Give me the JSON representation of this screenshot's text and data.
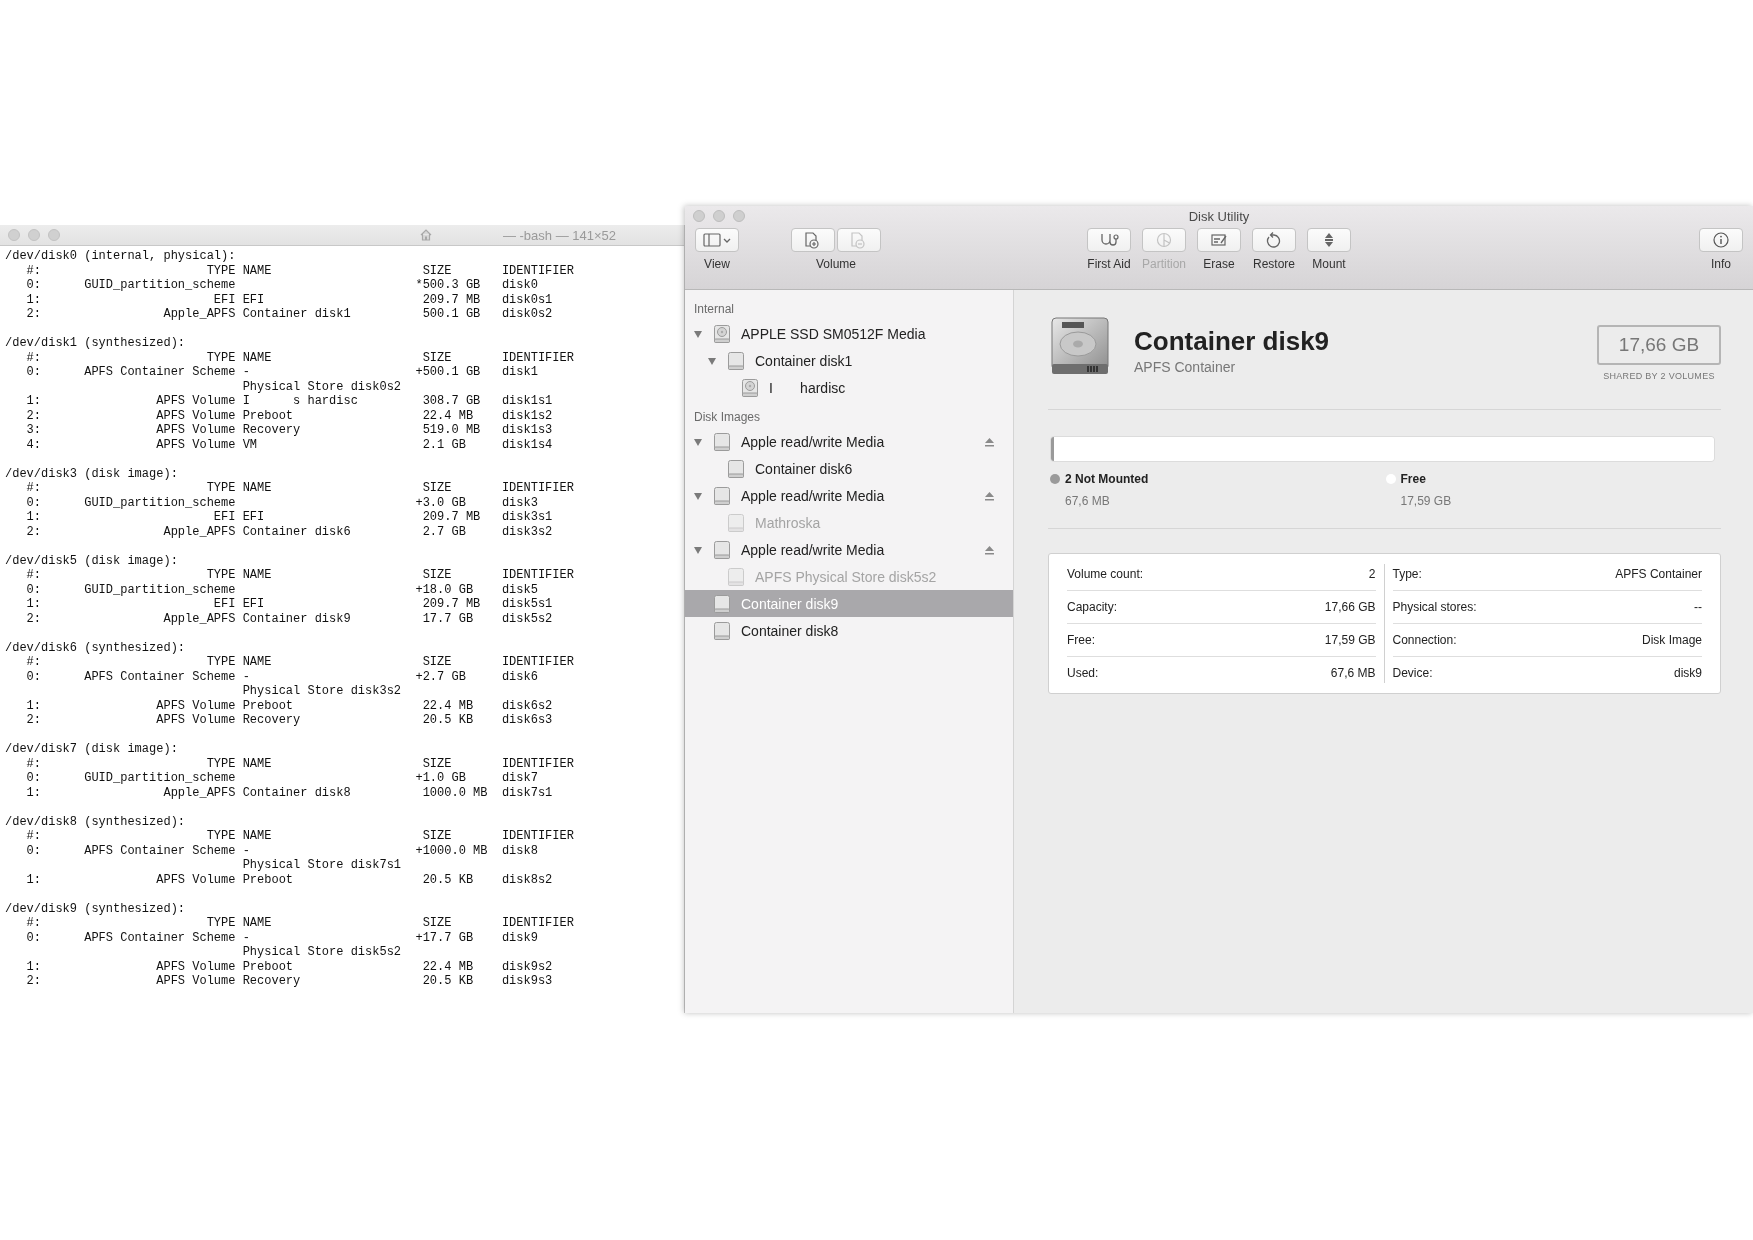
{
  "terminal": {
    "title": "— -bash — 141×52",
    "blocks": [
      {
        "header": "/dev/disk0 (internal, physical):",
        "lines": [
          "   #:                       TYPE NAME                     SIZE       IDENTIFIER",
          "   0:      GUID_partition_scheme                         *500.3 GB   disk0",
          "   1:                        EFI EFI                      209.7 MB   disk0s1",
          "   2:                 Apple_APFS Container disk1          500.1 GB   disk0s2"
        ]
      },
      {
        "header": "/dev/disk1 (synthesized):",
        "lines": [
          "   #:                       TYPE NAME                     SIZE       IDENTIFIER",
          "   0:      APFS Container Scheme -                       +500.1 GB   disk1",
          "                                 Physical Store disk0s2",
          "   1:                APFS Volume I      s hardisc         308.7 GB   disk1s1",
          "   2:                APFS Volume Preboot                  22.4 MB    disk1s2",
          "   3:                APFS Volume Recovery                 519.0 MB   disk1s3",
          "   4:                APFS Volume VM                       2.1 GB     disk1s4"
        ]
      },
      {
        "header": "/dev/disk3 (disk image):",
        "lines": [
          "   #:                       TYPE NAME                     SIZE       IDENTIFIER",
          "   0:      GUID_partition_scheme                         +3.0 GB     disk3",
          "   1:                        EFI EFI                      209.7 MB   disk3s1",
          "   2:                 Apple_APFS Container disk6          2.7 GB     disk3s2"
        ]
      },
      {
        "header": "/dev/disk5 (disk image):",
        "lines": [
          "   #:                       TYPE NAME                     SIZE       IDENTIFIER",
          "   0:      GUID_partition_scheme                         +18.0 GB    disk5",
          "   1:                        EFI EFI                      209.7 MB   disk5s1",
          "   2:                 Apple_APFS Container disk9          17.7 GB    disk5s2"
        ]
      },
      {
        "header": "/dev/disk6 (synthesized):",
        "lines": [
          "   #:                       TYPE NAME                     SIZE       IDENTIFIER",
          "   0:      APFS Container Scheme -                       +2.7 GB     disk6",
          "                                 Physical Store disk3s2",
          "   1:                APFS Volume Preboot                  22.4 MB    disk6s2",
          "   2:                APFS Volume Recovery                 20.5 KB    disk6s3"
        ]
      },
      {
        "header": "/dev/disk7 (disk image):",
        "lines": [
          "   #:                       TYPE NAME                     SIZE       IDENTIFIER",
          "   0:      GUID_partition_scheme                         +1.0 GB     disk7",
          "   1:                 Apple_APFS Container disk8          1000.0 MB  disk7s1"
        ]
      },
      {
        "header": "/dev/disk8 (synthesized):",
        "lines": [
          "   #:                       TYPE NAME                     SIZE       IDENTIFIER",
          "   0:      APFS Container Scheme -                       +1000.0 MB  disk8",
          "                                 Physical Store disk7s1",
          "   1:                APFS Volume Preboot                  20.5 KB    disk8s2"
        ]
      },
      {
        "header": "/dev/disk9 (synthesized):",
        "lines": [
          "   #:                       TYPE NAME                     SIZE       IDENTIFIER",
          "   0:      APFS Container Scheme -                       +17.7 GB    disk9",
          "                                 Physical Store disk5s2",
          "   1:                APFS Volume Preboot                  22.4 MB    disk9s2",
          "   2:                APFS Volume Recovery                 20.5 KB    disk9s3"
        ]
      }
    ]
  },
  "disk_utility": {
    "title": "Disk Utility",
    "toolbar": [
      {
        "label": "View",
        "buttons": [
          {
            "kind": "sidebar",
            "disabled": false
          }
        ]
      },
      {
        "label": "Volume",
        "buttons": [
          {
            "kind": "add",
            "disabled": false
          },
          {
            "kind": "remove",
            "disabled": true
          }
        ]
      },
      {
        "label": "First Aid",
        "buttons": [
          {
            "kind": "firstaid",
            "disabled": false
          }
        ]
      },
      {
        "label": "Partition",
        "buttons": [
          {
            "kind": "partition",
            "disabled": true
          }
        ]
      },
      {
        "label": "Erase",
        "buttons": [
          {
            "kind": "erase",
            "disabled": false
          }
        ]
      },
      {
        "label": "Restore",
        "buttons": [
          {
            "kind": "restore",
            "disabled": false
          }
        ]
      },
      {
        "label": "Mount",
        "buttons": [
          {
            "kind": "mount",
            "disabled": false
          }
        ]
      },
      {
        "label": "Info",
        "buttons": [
          {
            "kind": "info",
            "disabled": false
          }
        ]
      }
    ],
    "sidebar": [
      {
        "heading": "Internal",
        "items": [
          {
            "label": "APPLE SSD SM0512F Media",
            "kind": "drive",
            "expanded": true,
            "selected": false,
            "disabled": false,
            "ejectable": false,
            "children": [
              {
                "label": "Container disk1",
                "kind": "container",
                "expanded": true,
                "selected": false,
                "disabled": false,
                "ejectable": false,
                "children": [
                  {
                    "label": "I       hardisc",
                    "kind": "drive",
                    "selected": false,
                    "disabled": false,
                    "ejectable": false
                  }
                ]
              }
            ]
          }
        ]
      },
      {
        "heading": "Disk Images",
        "items": [
          {
            "label": "Apple read/write Media",
            "kind": "container",
            "expanded": true,
            "selected": false,
            "disabled": false,
            "ejectable": true,
            "children": [
              {
                "label": "Container disk6",
                "kind": "container",
                "selected": false,
                "disabled": false,
                "ejectable": false
              }
            ]
          },
          {
            "label": "Apple read/write Media",
            "kind": "container",
            "expanded": true,
            "selected": false,
            "disabled": false,
            "ejectable": true,
            "children": [
              {
                "label": "Mathroska",
                "kind": "container",
                "selected": false,
                "disabled": true,
                "ejectable": false
              }
            ]
          },
          {
            "label": "Apple read/write Media",
            "kind": "container",
            "expanded": true,
            "selected": false,
            "disabled": false,
            "ejectable": true,
            "children": [
              {
                "label": "APFS Physical Store disk5s2",
                "kind": "container",
                "selected": false,
                "disabled": true,
                "ejectable": false
              }
            ]
          },
          {
            "label": "Container disk9",
            "kind": "container",
            "selected": true,
            "disabled": false,
            "ejectable": false
          },
          {
            "label": "Container disk8",
            "kind": "container",
            "selected": false,
            "disabled": false,
            "ejectable": false
          }
        ]
      }
    ],
    "detail": {
      "name": "Container disk9",
      "subtitle": "APFS Container",
      "size": "17,66 GB",
      "shared": "SHARED BY 2 VOLUMES",
      "usage": [
        {
          "label": "2 Not Mounted",
          "value": "67,6 MB",
          "color": "#9a9a9a",
          "level": 0.004
        },
        {
          "label": "Free",
          "value": "17,59 GB",
          "color": "#ffffff",
          "level": 0.996
        }
      ],
      "info_left": [
        {
          "label": "Volume count:",
          "value": "2"
        },
        {
          "label": "Capacity:",
          "value": "17,66 GB"
        },
        {
          "label": "Free:",
          "value": "17,59 GB"
        },
        {
          "label": "Used:",
          "value": "67,6 MB"
        }
      ],
      "info_right": [
        {
          "label": "Type:",
          "value": "APFS Container"
        },
        {
          "label": "Physical stores:",
          "value": "--"
        },
        {
          "label": "Connection:",
          "value": "Disk Image"
        },
        {
          "label": "Device:",
          "value": "disk9"
        }
      ]
    }
  }
}
